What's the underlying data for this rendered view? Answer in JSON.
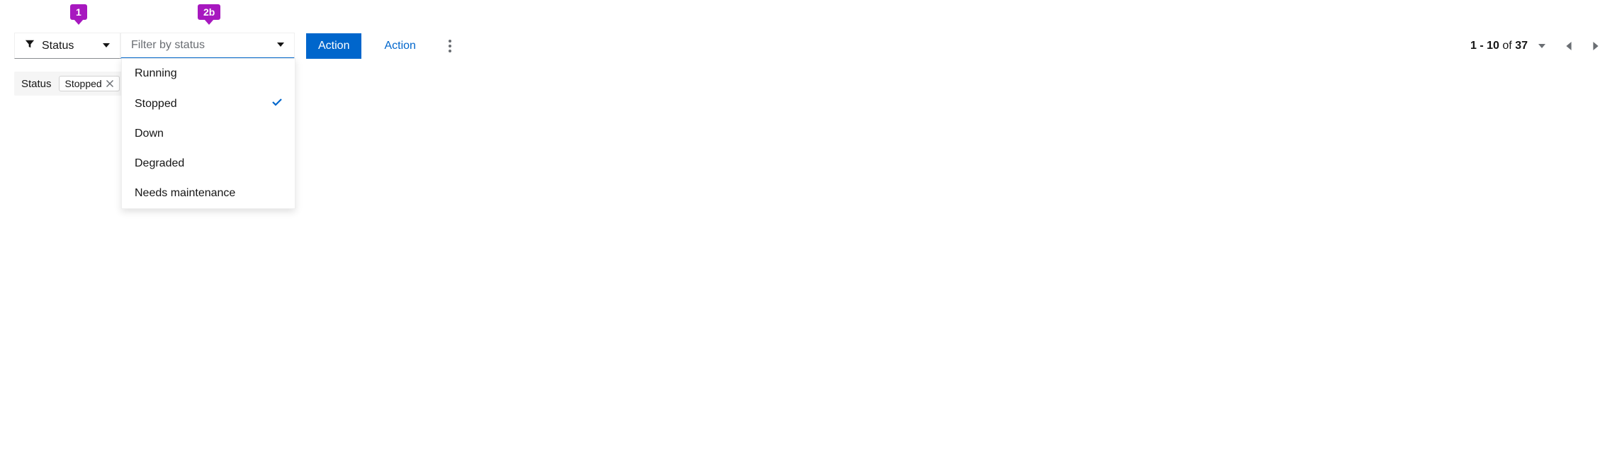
{
  "callouts": {
    "one": "1",
    "two_b": "2b"
  },
  "toolbar": {
    "attribute_label": "Status",
    "value_placeholder": "Filter by status",
    "primary_action": "Action",
    "secondary_action": "Action"
  },
  "dropdown": {
    "options": [
      {
        "label": "Running",
        "selected": false
      },
      {
        "label": "Stopped",
        "selected": true
      },
      {
        "label": "Down",
        "selected": false
      },
      {
        "label": "Degraded",
        "selected": false
      },
      {
        "label": "Needs maintenance",
        "selected": false
      }
    ]
  },
  "chips": {
    "group_label": "Status",
    "items": [
      {
        "label": "Stopped"
      }
    ]
  },
  "pagination": {
    "range_start": "1",
    "range_end": "10",
    "of_word": "of",
    "total": "37",
    "dash": " - "
  }
}
